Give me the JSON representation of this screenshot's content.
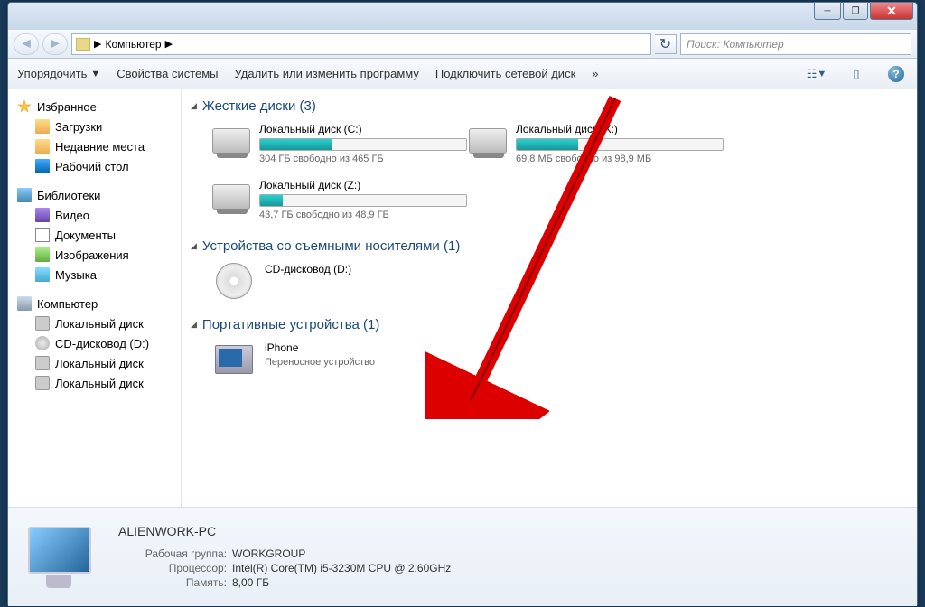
{
  "titlebar": {},
  "nav": {
    "breadcrumb": "Компьютер",
    "search_placeholder": "Поиск: Компьютер"
  },
  "toolbar": {
    "organize": "Упорядочить",
    "props": "Свойства системы",
    "uninstall": "Удалить или изменить программу",
    "netdrive": "Подключить сетевой диск",
    "more": "»"
  },
  "sidebar": {
    "favorites": "Избранное",
    "favorites_items": [
      "Загрузки",
      "Недавние места",
      "Рабочий стол"
    ],
    "libraries": "Библиотеки",
    "libraries_items": [
      "Видео",
      "Документы",
      "Изображения",
      "Музыка"
    ],
    "computer": "Компьютер",
    "computer_items": [
      "Локальный диск",
      "CD-дисковод (D:)",
      "Локальный диск",
      "Локальный диск"
    ]
  },
  "groups": {
    "hdd": "Жесткие диски (3)",
    "removable": "Устройства со съемными носителями (1)",
    "portable": "Портативные устройства (1)"
  },
  "drives": {
    "c": {
      "name": "Локальный диск (C:)",
      "free": "304 ГБ свободно из 465 ГБ",
      "pct": 35
    },
    "x": {
      "name": "Локальный диск (X:)",
      "free": "69,8 МБ свободно из 98,9 МБ",
      "pct": 30
    },
    "z": {
      "name": "Локальный диск (Z:)",
      "free": "43,7 ГБ свободно из 48,9 ГБ",
      "pct": 11
    },
    "d": {
      "name": "CD-дисковод (D:)"
    },
    "iphone": {
      "name": "iPhone",
      "sub": "Переносное устройство"
    }
  },
  "details": {
    "title": "ALIENWORK-PC",
    "workgroup_lbl": "Рабочая группа:",
    "workgroup": "WORKGROUP",
    "cpu_lbl": "Процессор:",
    "cpu": "Intel(R) Core(TM) i5-3230M CPU @ 2.60GHz",
    "mem_lbl": "Память:",
    "mem": "8,00 ГБ"
  }
}
